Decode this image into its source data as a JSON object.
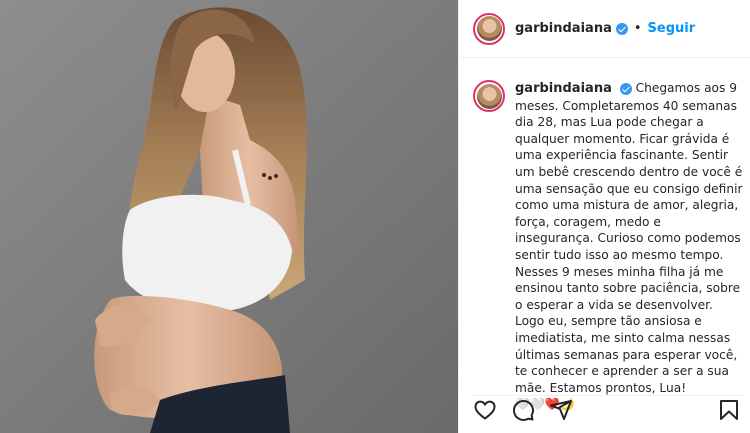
{
  "post": {
    "username": "garbindaiana",
    "follow_label": "Seguir",
    "separator": "•",
    "caption": "Chegamos aos 9 meses. Completaremos 40 semanas dia 28, mas Lua pode chegar a qualquer momento. Ficar grávida é uma experiência fascinante. Sentir um bebê crescendo dentro de você é uma sensação que eu consigo definir como uma mistura de amor, alegria, força, coragem, medo e insegurança. Curioso como podemos sentir tudo isso ao mesmo tempo. Nesses 9 meses minha filha já me ensinou tanto sobre paciência, sobre o esperar a vida se desenvolver. Logo eu, sempre tão ansiosa e imediatista, me sinto calma nessas últimas semanas para esperar você, te conhecer e aprender a ser a sua mãe. Estamos prontos, Lua!",
    "caption_emojis": "🤍🤍❤️🌙"
  },
  "colors": {
    "link_blue": "#0095f6",
    "verified_blue": "#3897f0",
    "text": "#262626"
  },
  "icons": [
    "heart-icon",
    "comment-icon",
    "share-icon",
    "bookmark-icon",
    "verified-badge-icon"
  ]
}
